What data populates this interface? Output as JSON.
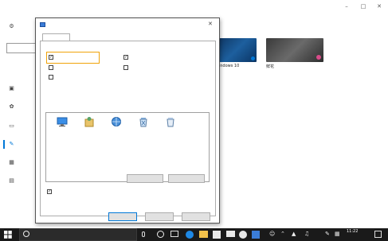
{
  "window": {
    "title": "",
    "minimize_icon": "minimize-icon",
    "maximize_icon": "maximize-icon",
    "close_icon": "close-icon"
  },
  "settings_nav": {
    "home_label": "",
    "search_placeholder": "",
    "section_title": "",
    "items": [
      {
        "icon": "image-icon",
        "label": ""
      },
      {
        "icon": "palette-icon",
        "label": ""
      },
      {
        "icon": "lock-screen-icon",
        "label": ""
      },
      {
        "icon": "brush-icon",
        "label": "",
        "selected": true
      },
      {
        "icon": "start-icon",
        "label": ""
      },
      {
        "icon": "taskbar-icon",
        "label": ""
      }
    ]
  },
  "themes": [
    {
      "name": "Windows 10",
      "sub": ""
    },
    {
      "name": "鲜花",
      "sub": ""
    }
  ],
  "dialog": {
    "title": "",
    "close_icon": "close-icon",
    "tab_label": "",
    "group_label": "",
    "checkboxes": [
      {
        "label": "",
        "checked": true
      },
      {
        "label": "",
        "checked": true
      },
      {
        "label": "",
        "checked": false
      },
      {
        "label": "",
        "checked": false
      },
      {
        "label": "",
        "checked": false
      }
    ],
    "desktop_icons": [
      {
        "icon": "computer-icon",
        "label": ""
      },
      {
        "icon": "user-folder-icon",
        "label": ""
      },
      {
        "icon": "network-icon",
        "label": ""
      },
      {
        "icon": "recycle-bin-full-icon",
        "label": ""
      },
      {
        "icon": "recycle-bin-empty-icon",
        "label": ""
      }
    ],
    "change_icon_label": "",
    "restore_default_label": "",
    "allow_themes_label": "",
    "allow_themes_checked": true,
    "ok_label": "",
    "cancel_label": "",
    "apply_label": ""
  },
  "taskbar": {
    "search_placeholder": "",
    "time": "11:22",
    "date": "",
    "ime": ""
  },
  "colors": {
    "accent": "#0078d7",
    "highlight": "#f0a30a",
    "taskbar": "#1a1a1a"
  }
}
